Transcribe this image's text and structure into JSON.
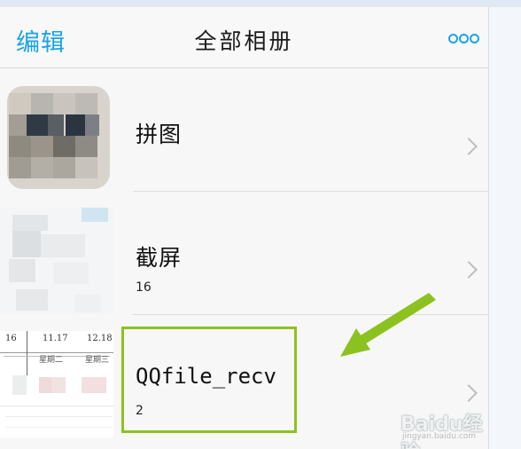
{
  "header": {
    "edit_label": "编辑",
    "title": "全部相册",
    "more_icon": "more-dots-icon"
  },
  "albums": [
    {
      "name": "拼图",
      "count": ""
    },
    {
      "name": "截屏",
      "count": "16"
    },
    {
      "name": "QQfile_recv",
      "count": "2"
    }
  ],
  "thumbnail_text": {
    "col1": "16",
    "col2": "11.17",
    "col3": "12.18",
    "week1": "星期二",
    "week2": "星期三"
  },
  "annotation": {
    "highlight_color": "#8cc21f",
    "arrow_color": "#8cc21f"
  },
  "watermark": {
    "brand": "Baidu经验",
    "url": "jingyan.baidu.com"
  },
  "colors": {
    "accent": "#1aa4e8",
    "background": "#f7f7f7"
  }
}
